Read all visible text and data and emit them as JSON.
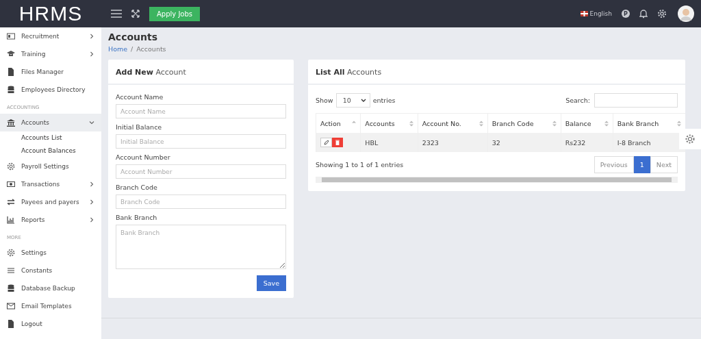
{
  "header": {
    "logo": "HRMS",
    "apply_button": "Apply Jobs",
    "language": "English",
    "profile_badge": "P"
  },
  "sidebar": {
    "items": [
      {
        "kind": "item",
        "label": "Recruitment",
        "has_arrow": true,
        "selected": false
      },
      {
        "kind": "item",
        "label": "Training",
        "has_arrow": true,
        "selected": false
      },
      {
        "kind": "item",
        "label": "Files Manager",
        "has_arrow": false,
        "selected": false
      },
      {
        "kind": "item",
        "label": "Employees Directory",
        "has_arrow": false,
        "selected": false
      },
      {
        "kind": "heading",
        "label": "ACCOUNTING"
      },
      {
        "kind": "item",
        "label": "Accounts",
        "has_arrow": true,
        "selected": true,
        "expanded": true,
        "children": [
          {
            "label": "Accounts List"
          },
          {
            "label": "Account Balances"
          }
        ]
      },
      {
        "kind": "item",
        "label": "Payroll Settings",
        "has_arrow": false,
        "selected": false
      },
      {
        "kind": "item",
        "label": "Transactions",
        "has_arrow": true,
        "selected": false
      },
      {
        "kind": "item",
        "label": "Payees and payers",
        "has_arrow": true,
        "selected": false
      },
      {
        "kind": "item",
        "label": "Reports",
        "has_arrow": true,
        "selected": false
      },
      {
        "kind": "heading",
        "label": "MORE"
      },
      {
        "kind": "item",
        "label": "Settings",
        "has_arrow": false,
        "selected": false
      },
      {
        "kind": "item",
        "label": "Constants",
        "has_arrow": false,
        "selected": false
      },
      {
        "kind": "item",
        "label": "Database Backup",
        "has_arrow": false,
        "selected": false
      },
      {
        "kind": "item",
        "label": "Email Templates",
        "has_arrow": false,
        "selected": false
      },
      {
        "kind": "item",
        "label": "Logout",
        "has_arrow": false,
        "selected": false
      }
    ]
  },
  "page_title": "Accounts",
  "breadcrumb": [
    {
      "kind": "link",
      "label": "Home"
    },
    {
      "kind": "separator",
      "label": "/"
    },
    {
      "kind": "current",
      "label": "Accounts"
    }
  ],
  "form": {
    "title": "**Add New** Account",
    "fields": [
      {
        "kind": "input",
        "label": "Account Name",
        "placeholder": "Account Name"
      },
      {
        "kind": "input",
        "label": "Initial Balance",
        "placeholder": "Initial Balance"
      },
      {
        "kind": "input",
        "label": "Account Number",
        "placeholder": "Account Number"
      },
      {
        "kind": "input",
        "label": "Branch Code",
        "placeholder": "Branch Code"
      },
      {
        "kind": "textarea",
        "label": "Bank Branch",
        "placeholder": "Bank Branch"
      }
    ],
    "save_button": "Save"
  },
  "list": {
    "title": "**List All** Accounts",
    "show_label": "Show",
    "page_size": "10",
    "entries_label": "entries",
    "search_label": "Search:",
    "columns": [
      "Action",
      "Accounts",
      "Account No.",
      "Branch Code",
      "Balance",
      "Bank Branch"
    ],
    "rows": [
      {
        "cells": [
          "",
          "HBL",
          "2323",
          "32",
          "Rs232",
          "I-8 Branch"
        ]
      }
    ],
    "info": "Showing 1 to 1 of 1 entries",
    "pagination": [
      {
        "label": "Previous",
        "selected": false
      },
      {
        "label": "1",
        "selected": true
      },
      {
        "label": "Next",
        "selected": false
      }
    ]
  }
}
